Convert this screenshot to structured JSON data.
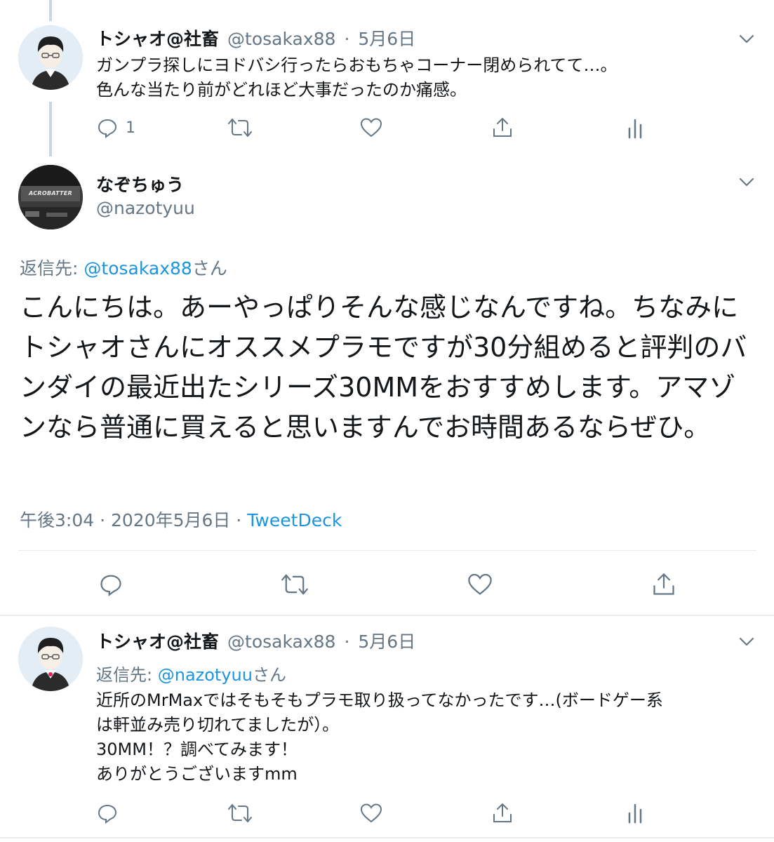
{
  "tweet1": {
    "name": "トシャオ@社畜",
    "handle": "@tosakax88",
    "separator": "·",
    "date": "5月6日",
    "text_line1": "ガンプラ探しにヨドバシ行ったらおもちゃコーナー閉められてて…。",
    "text_line2": "色んな当たり前がどれほど大事だったのか痛感。",
    "reply_count": "1"
  },
  "main_tweet": {
    "name": "なぞちゅう",
    "handle": "@nazotyuu",
    "avatar_text": "ACROBATTER",
    "reply_to_label": "返信先:",
    "reply_to_handle": "@tosakax88",
    "reply_to_suffix": "さん",
    "text": "こんにちは。あーやっぱりそんな感じなんですね。ちなみにトシャオさんにオススメプラモですが30分組めると評判のバンダイの最近出たシリーズ30MMをおすすめします。アマゾンなら普通に買えると思いますんでお時間あるならぜひ。",
    "time": "午後3:04",
    "separator": "·",
    "date": "2020年5月6日",
    "source": "TweetDeck"
  },
  "tweet3": {
    "name": "トシャオ@社畜",
    "handle": "@tosakax88",
    "separator": "·",
    "date": "5月6日",
    "reply_to_label": "返信先:",
    "reply_to_handle": "@nazotyuu",
    "reply_to_suffix": "さん",
    "text_line1": "近所のMrMaxではそもそもプラモ取り扱ってなかったです…(ボードゲー系",
    "text_line2": "は軒並み売り切れてましたが）。",
    "text_line3": "30MM！？調べてみます！",
    "text_line4": "ありがとうございますmm"
  },
  "icons": [
    "reply-icon",
    "retweet-icon",
    "like-icon",
    "share-icon",
    "analytics-icon",
    "chevron-down-icon"
  ],
  "colors": {
    "link": "#1b95e0",
    "secondary_text": "#657786",
    "divider": "#e6ecf0",
    "thread_line": "#ccd6dd"
  }
}
